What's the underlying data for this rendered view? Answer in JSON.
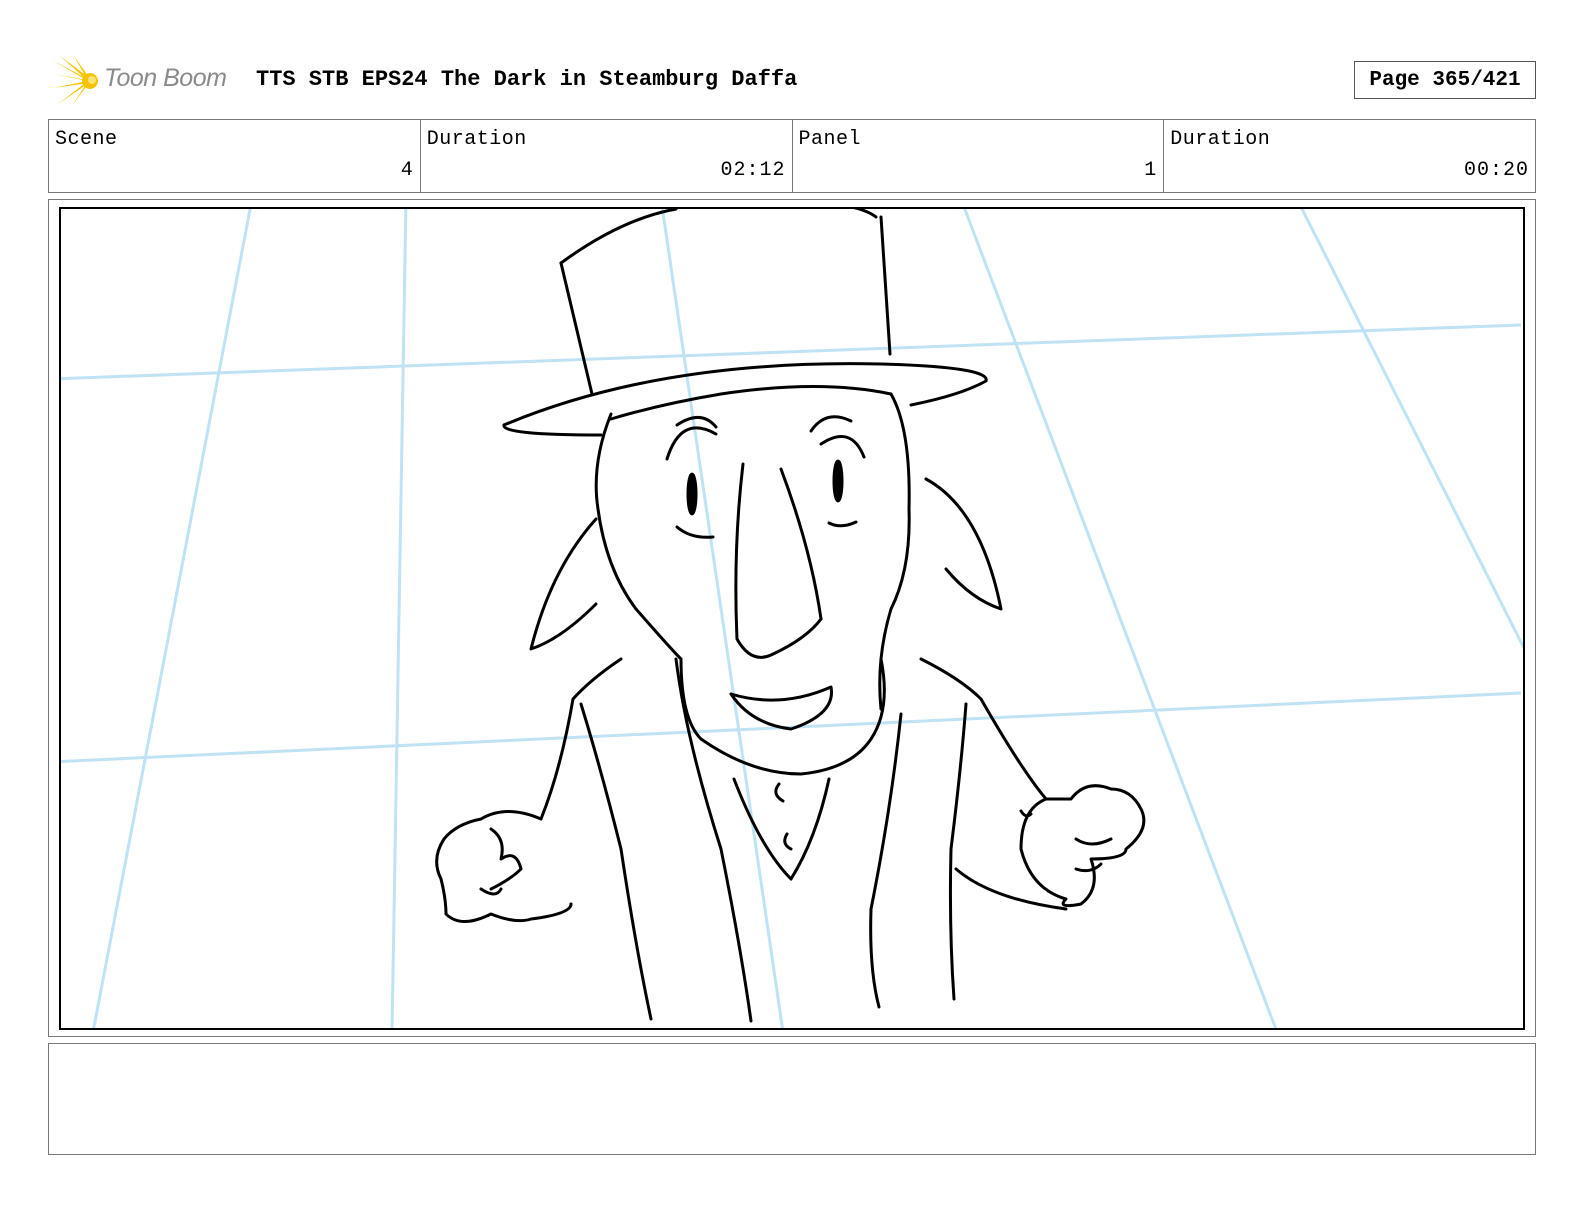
{
  "header": {
    "logo_text": "Toon Boom",
    "title": "TTS STB EPS24 The Dark in Steamburg Daffa",
    "page": "Page 365/421"
  },
  "info": {
    "scene_label": "Scene",
    "scene_value": "4",
    "scene_duration_label": "Duration",
    "scene_duration_value": "02:12",
    "panel_label": "Panel",
    "panel_value": "1",
    "panel_duration_label": "Duration",
    "panel_duration_value": "00:20"
  },
  "notes": {
    "text": ""
  },
  "colors": {
    "guide_lines": "#bfe3f5",
    "ink": "#000000",
    "logo_yellow": "#f5c400"
  }
}
